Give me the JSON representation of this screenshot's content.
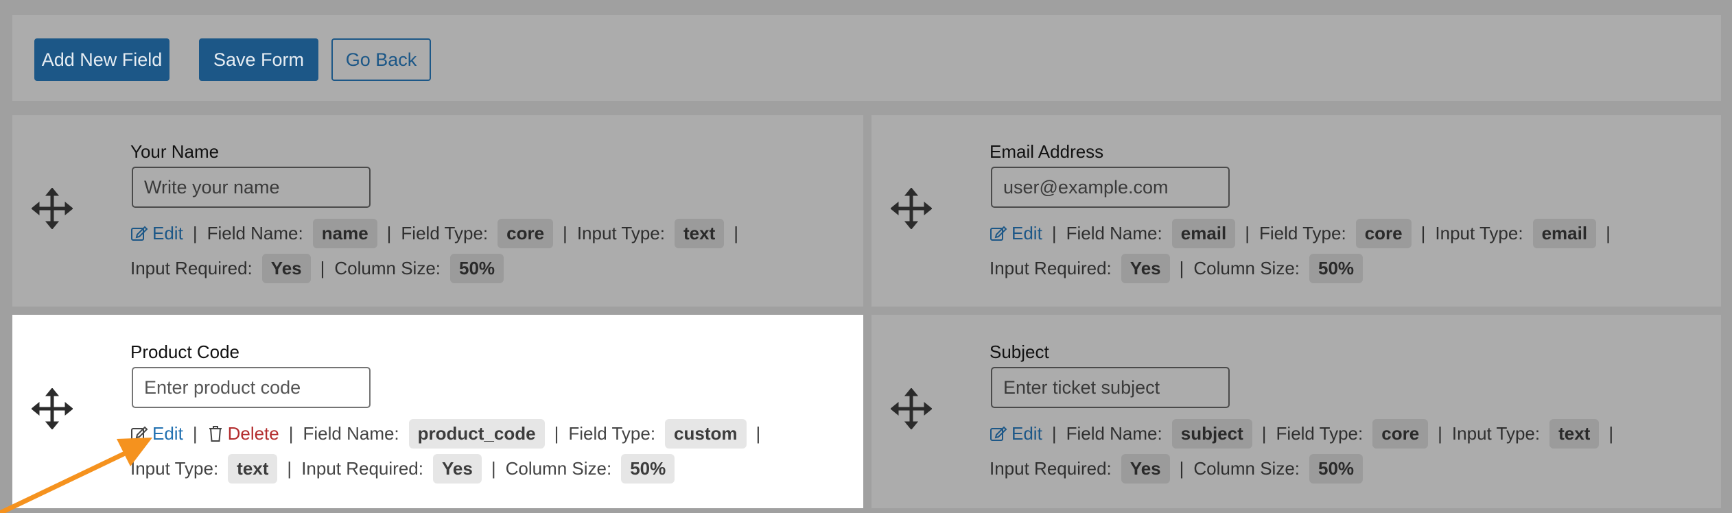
{
  "toolbar": {
    "add_label": "Add New Field",
    "save_label": "Save Form",
    "back_label": "Go Back"
  },
  "labels": {
    "edit": "Edit",
    "delete": "Delete",
    "field_name": "Field Name:",
    "field_type": "Field Type:",
    "input_type": "Input Type:",
    "input_required": "Input Required:",
    "column_size": "Column Size:",
    "separator": "|"
  },
  "fields": [
    {
      "title": "Your Name",
      "placeholder": "Write your name",
      "field_name": "name",
      "field_type": "core",
      "input_type": "text",
      "input_required": "Yes",
      "column_size": "50%"
    },
    {
      "title": "Email Address",
      "placeholder": "user@example.com",
      "field_name": "email",
      "field_type": "core",
      "input_type": "email",
      "input_required": "Yes",
      "column_size": "50%"
    },
    {
      "title": "Product Code",
      "placeholder": "Enter product code",
      "field_name": "product_code",
      "field_type": "custom",
      "input_type": "text",
      "input_required": "Yes",
      "column_size": "50%"
    },
    {
      "title": "Subject",
      "placeholder": "Enter ticket subject",
      "field_name": "subject",
      "field_type": "core",
      "input_type": "text",
      "input_required": "Yes",
      "column_size": "50%"
    }
  ],
  "colors": {
    "primary": "#1c5787",
    "link": "#2271b1",
    "delete": "#b32d2e",
    "overlay_bg": "#a0a0a0",
    "annotation_arrow": "#f5921e"
  },
  "icons": {
    "move": "move-arrows-icon",
    "edit": "pencil-square-icon",
    "delete": "trash-icon"
  }
}
